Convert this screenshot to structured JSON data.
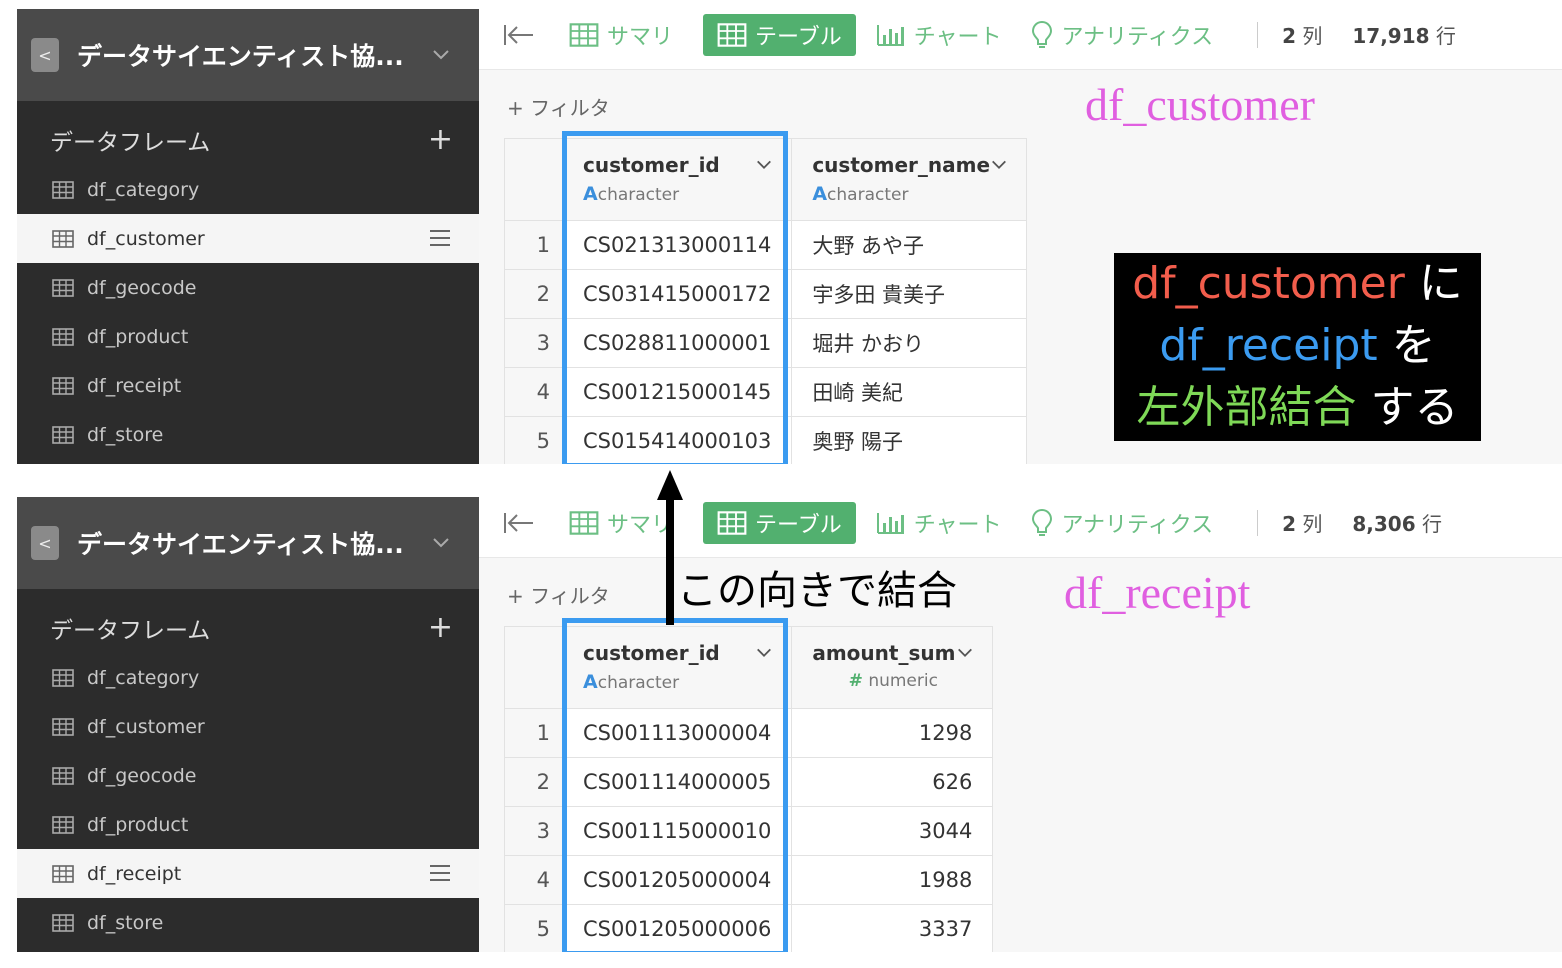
{
  "top": {
    "sidebar": {
      "title": "データサイエンティスト協...",
      "section": "データフレーム",
      "items": [
        {
          "label": "df_category",
          "active": false
        },
        {
          "label": "df_customer",
          "active": true
        },
        {
          "label": "df_geocode",
          "active": false
        },
        {
          "label": "df_product",
          "active": false
        },
        {
          "label": "df_receipt",
          "active": false
        },
        {
          "label": "df_store",
          "active": false
        }
      ]
    },
    "toolbar": {
      "summary": "サマリ",
      "table": "テーブル",
      "chart": "チャート",
      "analytics": "アナリティクス",
      "cols_num": "2",
      "cols_unit": "列",
      "rows_num": "17,918",
      "rows_unit": "行"
    },
    "filter": "+ フィルタ",
    "df_label": "df_customer",
    "table": {
      "columns": [
        {
          "name": "customer_id",
          "type_icon": "A",
          "type": "character"
        },
        {
          "name": "customer_name",
          "type_icon": "A",
          "type": "character"
        }
      ],
      "rows": [
        {
          "n": "1",
          "c1": "CS021313000114",
          "c2": "大野 あや子"
        },
        {
          "n": "2",
          "c1": "CS031415000172",
          "c2": "宇多田 貴美子"
        },
        {
          "n": "3",
          "c1": "CS028811000001",
          "c2": "堀井 かおり"
        },
        {
          "n": "4",
          "c1": "CS001215000145",
          "c2": "田崎 美紀"
        },
        {
          "n": "5",
          "c1": "CS015414000103",
          "c2": "奥野 陽子"
        }
      ]
    }
  },
  "bottom": {
    "sidebar": {
      "title": "データサイエンティスト協...",
      "section": "データフレーム",
      "items": [
        {
          "label": "df_category",
          "active": false
        },
        {
          "label": "df_customer",
          "active": false
        },
        {
          "label": "df_geocode",
          "active": false
        },
        {
          "label": "df_product",
          "active": false
        },
        {
          "label": "df_receipt",
          "active": true
        },
        {
          "label": "df_store",
          "active": false
        }
      ]
    },
    "toolbar": {
      "summary": "サマリ",
      "table": "テーブル",
      "chart": "チャート",
      "analytics": "アナリティクス",
      "cols_num": "2",
      "cols_unit": "列",
      "rows_num": "8,306",
      "rows_unit": "行"
    },
    "filter": "+ フィルタ",
    "df_label": "df_receipt",
    "table": {
      "columns": [
        {
          "name": "customer_id",
          "type_icon": "A",
          "type": "character"
        },
        {
          "name": "amount_sum",
          "type_icon": "#",
          "type": "numeric"
        }
      ],
      "rows": [
        {
          "n": "1",
          "c1": "CS001113000004",
          "c2": "1298"
        },
        {
          "n": "2",
          "c1": "CS001114000005",
          "c2": "626"
        },
        {
          "n": "3",
          "c1": "CS001115000010",
          "c2": "3044"
        },
        {
          "n": "4",
          "c1": "CS001205000004",
          "c2": "1988"
        },
        {
          "n": "5",
          "c1": "CS001205000006",
          "c2": "3337"
        }
      ]
    }
  },
  "annotation": {
    "line1_a": "df_customer",
    "line1_b": " に",
    "line2_a": "df_receipt",
    "line2_b": " を",
    "line3_a": "左外部結合",
    "line3_b": " する",
    "arrow_text": "この向きで結合"
  },
  "colors": {
    "accent_green": "#52b06f",
    "highlight_blue": "#3b9bf0",
    "label_magenta": "#e05fe0"
  }
}
